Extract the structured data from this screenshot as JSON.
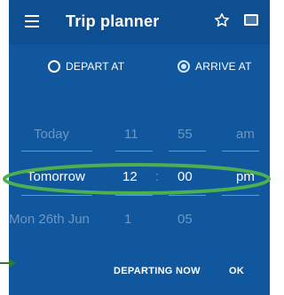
{
  "app": {
    "title": "Trip planner"
  },
  "header": {
    "menu_icon": "hamburger-menu-icon",
    "star_icon": "star-outline-icon",
    "tablet_icon": "tablet-icon"
  },
  "mode": {
    "options": [
      {
        "label": "DEPART AT",
        "selected": false
      },
      {
        "label": "ARRIVE AT",
        "selected": true
      }
    ]
  },
  "picker": {
    "separator": ":",
    "rows": [
      {
        "day": "Today",
        "hour": "11",
        "minute": "55",
        "ampm": "am"
      },
      {
        "day": "Tomorrow",
        "hour": "12",
        "minute": "00",
        "ampm": "pm"
      },
      {
        "day": "Mon 26th Jun",
        "hour": "1",
        "minute": "05",
        "ampm": ""
      }
    ],
    "selected_index": 1
  },
  "actions": {
    "departing_now": "DEPARTING NOW",
    "ok": "OK"
  },
  "colors": {
    "background": "#11579d",
    "appbar": "#0d4f90",
    "dim_text": "#6c96c4",
    "divider": "#4ea0e6",
    "annotation": "#4caf50"
  }
}
